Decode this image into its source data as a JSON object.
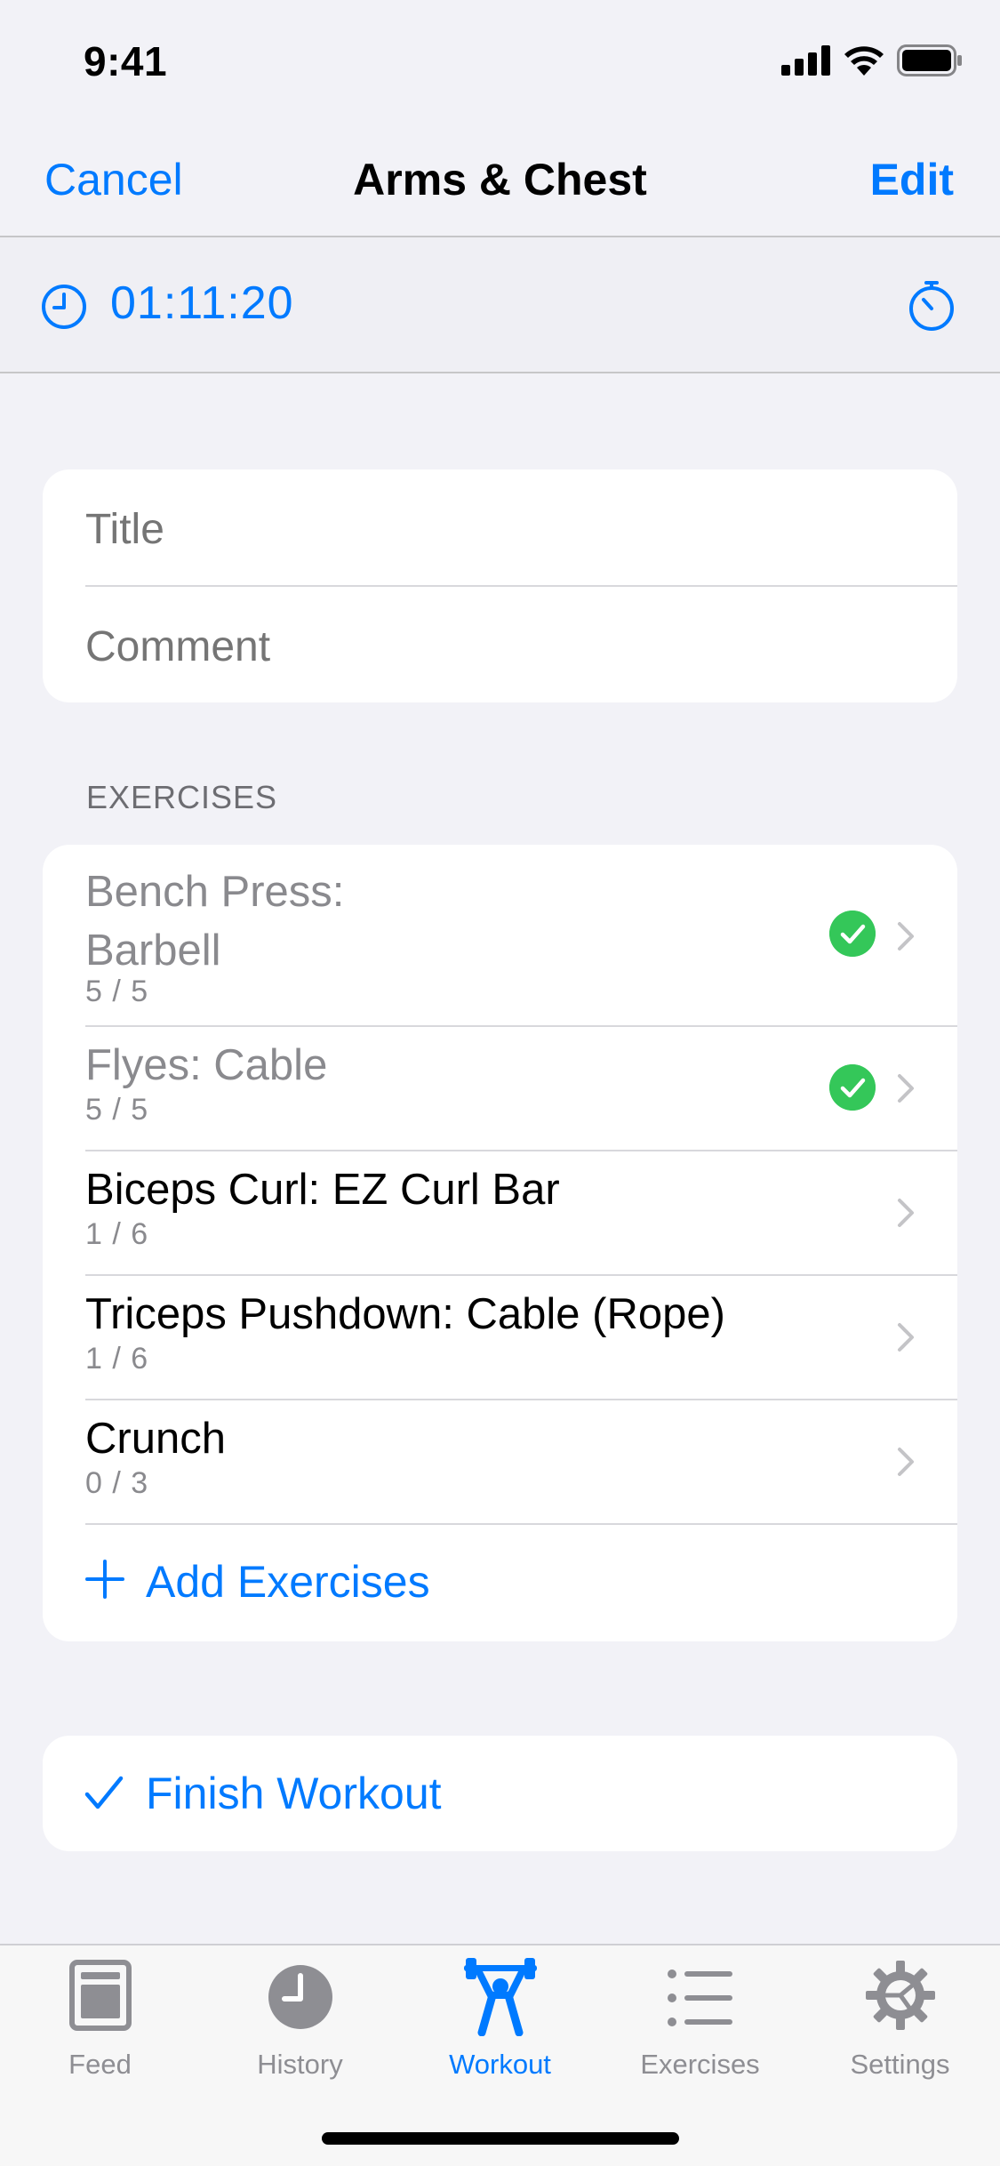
{
  "status_bar": {
    "time": "9:41"
  },
  "nav": {
    "cancel_label": "Cancel",
    "title": "Arms & Chest",
    "edit_label": "Edit"
  },
  "timer": {
    "elapsed": "01:11:20"
  },
  "workout_info": {
    "title_placeholder": "Title",
    "comment_placeholder": "Comment"
  },
  "exercises_section": {
    "header": "EXERCISES",
    "items": [
      {
        "name_line1": "Bench Press:",
        "name_line2": "Barbell",
        "progress": "5 / 5",
        "completed": true
      },
      {
        "name_line1": "Flyes: Cable",
        "progress": "5 / 5",
        "completed": true
      },
      {
        "name_line1": "Biceps Curl: EZ Curl Bar",
        "progress": "1 / 6",
        "completed": false
      },
      {
        "name_line1": "Triceps Pushdown: Cable (Rope)",
        "progress": "1 / 6",
        "completed": false
      },
      {
        "name_line1": "Crunch",
        "progress": "0 / 3",
        "completed": false
      }
    ],
    "add_label": "Add Exercises"
  },
  "finish": {
    "label": "Finish Workout"
  },
  "tabbar": {
    "tabs": [
      {
        "label": "Feed",
        "icon": "feed-icon"
      },
      {
        "label": "History",
        "icon": "history-icon"
      },
      {
        "label": "Workout",
        "icon": "workout-icon",
        "active": true
      },
      {
        "label": "Exercises",
        "icon": "exercises-list-icon"
      },
      {
        "label": "Settings",
        "icon": "settings-gear-icon"
      }
    ]
  },
  "colors": {
    "accent": "#007aff",
    "success": "#34c759",
    "background": "#f2f2f7",
    "secondary_text": "#8a8a8e"
  }
}
